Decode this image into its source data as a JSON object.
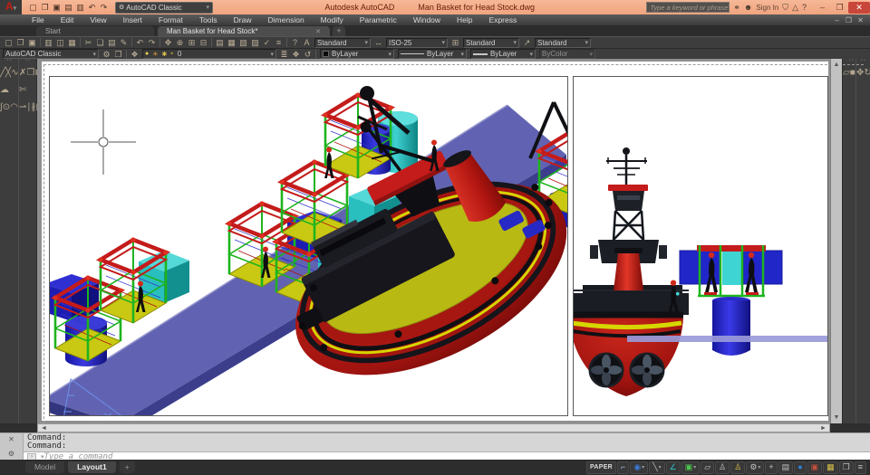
{
  "glyphs": {
    "caret": "▾",
    "close": "✕",
    "minimize": "–",
    "restore": "❐",
    "up": "▲",
    "down": "▼",
    "left": "◄",
    "right": "►",
    "grip": "• •",
    "gear": "⚙",
    "keyboard_box": "›"
  },
  "colors": {
    "titlebar_bg": "#f0a47e",
    "close_btn": "#c9473a",
    "platform_top": "#6163b2",
    "platform_side": "#3c3e8c",
    "platform_edge": "#9b9bd0",
    "cage_green": "#1eb41e",
    "cage_red": "#c41b1b",
    "base_yellow": "#c9c913",
    "teal_box": "#2abfbf",
    "teal_top": "#55d8d8",
    "navy_box": "#1d1db4",
    "navy_top": "#2f2fd2",
    "cyl_blue": "#2a2ad2",
    "hull_red": "#a81510",
    "hull_dark": "#7a0c09",
    "stripe_yellow": "#d6d600",
    "deck_yellow": "#b9b913",
    "structure_black": "#15151b",
    "lavender_bar": "#9a9ada",
    "helmet_red": "#d42a1a",
    "cyan_panel": "#3fd4d4"
  },
  "titlebar": {
    "logo_letter": "A",
    "qat_icons": [
      {
        "name": "qnew-icon",
        "glyph": "▢"
      },
      {
        "name": "open-icon",
        "glyph": "❐"
      },
      {
        "name": "save-icon",
        "glyph": "▣"
      },
      {
        "name": "save-as-icon",
        "glyph": "▤"
      },
      {
        "name": "plot-icon",
        "glyph": "▥"
      },
      {
        "name": "undo-icon",
        "glyph": "↶"
      },
      {
        "name": "redo-icon",
        "glyph": "↷"
      }
    ],
    "workspace": "AutoCAD Classic",
    "app_title": "Autodesk AutoCAD",
    "doc_title": "Man Basket for Head Stock.dwg"
  },
  "infocenter": {
    "search_placeholder": "Type a keyword or phrase",
    "icons": [
      {
        "name": "search-binoculars-icon",
        "glyph": "⚭"
      },
      {
        "name": "sign-in-user-icon",
        "glyph": "☻"
      }
    ],
    "sign_in": "Sign In",
    "right_icons": [
      {
        "name": "dropdown-icon",
        "glyph": "▾"
      },
      {
        "name": "exchange-apps-icon",
        "glyph": "⛉"
      },
      {
        "name": "autodesk360-icon",
        "glyph": "△"
      },
      {
        "name": "help-icon",
        "glyph": "?"
      }
    ]
  },
  "menus": [
    "File",
    "Edit",
    "View",
    "Insert",
    "Format",
    "Tools",
    "Draw",
    "Dimension",
    "Modify",
    "Parametric",
    "Window",
    "Help",
    "Express"
  ],
  "file_tabs": {
    "start": "Start",
    "active": "Man Basket for Head Stock*",
    "add": "+"
  },
  "toolbar_row1": {
    "icons": [
      {
        "name": "qnew-icon",
        "glyph": "▢"
      },
      {
        "name": "open-icon",
        "glyph": "❐"
      },
      {
        "name": "save-icon",
        "glyph": "▣"
      },
      {
        "name": "sep"
      },
      {
        "name": "plot-icon",
        "glyph": "▥"
      },
      {
        "name": "plot-preview-icon",
        "glyph": "◫"
      },
      {
        "name": "publish-icon",
        "glyph": "▦"
      },
      {
        "name": "sep"
      },
      {
        "name": "cut-icon",
        "glyph": "✂"
      },
      {
        "name": "copy-clip-icon",
        "glyph": "❏"
      },
      {
        "name": "paste-icon",
        "glyph": "▤"
      },
      {
        "name": "match-properties-icon",
        "glyph": "✎"
      },
      {
        "name": "sep"
      },
      {
        "name": "undo-icon",
        "glyph": "↶"
      },
      {
        "name": "redo-icon",
        "glyph": "↷"
      },
      {
        "name": "sep"
      },
      {
        "name": "pan-icon",
        "glyph": "✥"
      },
      {
        "name": "zoom-realtime-icon",
        "glyph": "⊕"
      },
      {
        "name": "zoom-window-icon",
        "glyph": "⊞"
      },
      {
        "name": "zoom-previous-icon",
        "glyph": "⊟"
      },
      {
        "name": "sep"
      },
      {
        "name": "properties-icon",
        "glyph": "▤"
      },
      {
        "name": "designcenter-icon",
        "glyph": "▦"
      },
      {
        "name": "tool-palettes-icon",
        "glyph": "▧"
      },
      {
        "name": "sheet-set-manager-icon",
        "glyph": "▨"
      },
      {
        "name": "markup-icon",
        "glyph": "✓"
      },
      {
        "name": "quickcalc-icon",
        "glyph": "≡"
      },
      {
        "name": "sep"
      },
      {
        "name": "help-icon",
        "glyph": "?"
      }
    ],
    "text_style_icon": "A",
    "text_style": "Standard",
    "dim_style_icon": "↔",
    "dim_style": "ISO-25",
    "table_style_icon": "⊞",
    "table_style": "Standard",
    "mleader_style_icon": "↗",
    "mleader_style": "Standard"
  },
  "toolbar_row2": {
    "workspace": "AutoCAD Classic",
    "gear_icon": "⚙",
    "capture_icon": "❐",
    "layer_tool_icon": "❖",
    "layer_states_icons": [
      {
        "name": "layer-on-bulb-icon",
        "glyph": "●",
        "color": "#e8d24a"
      },
      {
        "name": "layer-freeze-sun-icon",
        "glyph": "☀",
        "color": "#e8a23a"
      },
      {
        "name": "layer-plot-icon",
        "glyph": "✱",
        "color": "#d8c24a"
      },
      {
        "name": "layer-lock-icon",
        "glyph": "▪",
        "color": "#c8b030"
      }
    ],
    "layer_name": "0",
    "layer_extra_icons": [
      {
        "name": "layer-properties-icon",
        "glyph": "≣"
      },
      {
        "name": "make-layer-current-icon",
        "glyph": "❖"
      },
      {
        "name": "layer-previous-icon",
        "glyph": "↺"
      }
    ],
    "color": "ByLayer",
    "linetype": "ByLayer",
    "lineweight": "ByLayer",
    "plot_style": "ByColor"
  },
  "side_toolbars": {
    "draw": [
      {
        "name": "line-icon",
        "glyph": "╱"
      },
      {
        "name": "construction-line-icon",
        "glyph": "╳"
      },
      {
        "name": "polyline-icon",
        "glyph": "∿"
      },
      {
        "name": "polygon-icon",
        "glyph": "◇"
      },
      {
        "name": "rectangle-icon",
        "glyph": "▭"
      },
      {
        "name": "arc-icon",
        "glyph": "⌢"
      },
      {
        "name": "circle-icon",
        "glyph": "○"
      },
      {
        "name": "revision-cloud-icon",
        "glyph": "☁"
      },
      {
        "name": "spline-icon",
        "glyph": "∫"
      },
      {
        "name": "ellipse-icon",
        "glyph": "⊙"
      },
      {
        "name": "ellipse-arc-icon",
        "glyph": "◠"
      },
      {
        "name": "insert-block-icon",
        "glyph": "⊡"
      },
      {
        "name": "make-block-icon",
        "glyph": "⊞"
      },
      {
        "name": "point-icon",
        "glyph": "∙"
      },
      {
        "name": "hatch-icon",
        "glyph": "▨"
      },
      {
        "name": "gradient-icon",
        "glyph": "▓"
      },
      {
        "name": "region-icon",
        "glyph": "▣"
      },
      {
        "name": "table-icon",
        "glyph": "⊞"
      },
      {
        "name": "multiline-text-icon",
        "glyph": "A"
      },
      {
        "name": "add-selected-icon",
        "glyph": "✛"
      }
    ],
    "modify": [
      {
        "name": "erase-icon",
        "glyph": "✗"
      },
      {
        "name": "copy-icon",
        "glyph": "❐"
      },
      {
        "name": "mirror-icon",
        "glyph": "⋈"
      },
      {
        "name": "offset-icon",
        "glyph": "∥"
      },
      {
        "name": "array-icon",
        "glyph": "⣿"
      },
      {
        "name": "move-icon",
        "glyph": "✥"
      },
      {
        "name": "rotate-icon",
        "glyph": "↻"
      },
      {
        "name": "scale-icon",
        "glyph": "↗"
      },
      {
        "name": "stretch-icon",
        "glyph": "↔"
      },
      {
        "name": "trim-icon",
        "glyph": "✄"
      },
      {
        "name": "extend-icon",
        "glyph": "⇀"
      },
      {
        "name": "break-at-point-icon",
        "glyph": "∣"
      },
      {
        "name": "break-icon",
        "glyph": "∦"
      },
      {
        "name": "join-icon",
        "glyph": "∪"
      },
      {
        "name": "chamfer-icon",
        "glyph": "∠"
      },
      {
        "name": "fillet-icon",
        "glyph": "◜"
      },
      {
        "name": "blend-curves-icon",
        "glyph": "≈"
      },
      {
        "name": "explode-icon",
        "glyph": "✳"
      }
    ],
    "modeling": [
      {
        "name": "polysolid-icon",
        "glyph": "▱"
      },
      {
        "name": "box-icon",
        "glyph": "■"
      },
      {
        "name": "wedge-icon",
        "glyph": "◢"
      },
      {
        "name": "cone-icon",
        "glyph": "▲"
      },
      {
        "name": "sphere-icon",
        "glyph": "●"
      },
      {
        "name": "cylinder-icon",
        "glyph": "▮"
      },
      {
        "name": "torus-icon",
        "glyph": "◎"
      },
      {
        "name": "pyramid-icon",
        "glyph": "△"
      },
      {
        "name": "helix-icon",
        "glyph": "§"
      },
      {
        "name": "planar-surface-icon",
        "glyph": "▰"
      },
      {
        "name": "extrude-icon",
        "glyph": "⇧"
      },
      {
        "name": "presspull-icon",
        "glyph": "⇩"
      },
      {
        "name": "sweep-icon",
        "glyph": "∿"
      },
      {
        "name": "revolve-icon",
        "glyph": "↻"
      },
      {
        "name": "loft-icon",
        "glyph": "≋"
      },
      {
        "name": "union-icon",
        "glyph": "∪"
      },
      {
        "name": "subtract-icon",
        "glyph": "∖"
      },
      {
        "name": "intersect-icon",
        "glyph": "∩"
      }
    ],
    "solids": [
      {
        "name": "3d-move-icon",
        "glyph": "✥"
      },
      {
        "name": "3d-rotate-icon",
        "glyph": "↻"
      },
      {
        "name": "3d-align-icon",
        "glyph": "≡"
      },
      {
        "name": "3d-array-icon",
        "glyph": "⣿"
      },
      {
        "name": "3d-mirror-icon",
        "glyph": "⋈"
      },
      {
        "name": "fillet-edge-icon",
        "glyph": "◜"
      },
      {
        "name": "taper-faces-icon",
        "glyph": "◣"
      },
      {
        "name": "shell-icon",
        "glyph": "▢"
      },
      {
        "name": "slice-icon",
        "glyph": "◪"
      },
      {
        "name": "thicken-icon",
        "glyph": "▣"
      },
      {
        "name": "interfere-icon",
        "glyph": "◍"
      },
      {
        "name": "extract-edges-icon",
        "glyph": "◫"
      },
      {
        "name": "imprint-icon",
        "glyph": "◧"
      },
      {
        "name": "color-faces-icon",
        "glyph": "◨"
      },
      {
        "name": "copy-faces-icon",
        "glyph": "◩"
      },
      {
        "name": "check-icon",
        "glyph": "✓"
      },
      {
        "name": "sculpt-icon",
        "glyph": "◆"
      },
      {
        "name": "separate-icon",
        "glyph": "◊"
      }
    ]
  },
  "command": {
    "lines": [
      "Command:",
      "Command:"
    ],
    "placeholder": "Type a command"
  },
  "layout_tabs": {
    "model": "Model",
    "layout1": "Layout1",
    "add": "+"
  },
  "status_bar": {
    "paper": "PAPER",
    "icons": [
      {
        "name": "infer-constraints-icon",
        "glyph": "⌐",
        "color": "#9db6cf"
      },
      {
        "name": "snap-mode-icon",
        "glyph": "◉",
        "color": "#3d7bd8",
        "caret": true
      },
      {
        "name": "polar-tracking-icon",
        "glyph": "╲",
        "color": "#c2c2c2",
        "caret": true
      },
      {
        "name": "isometric-drafting-icon",
        "glyph": "∠",
        "color": "#29c5c5"
      },
      {
        "name": "object-snap-icon",
        "glyph": "▣",
        "color": "#4ec44e",
        "caret": true
      },
      {
        "name": "show-annotation-objects-icon",
        "glyph": "▱",
        "color": "#c2c2c2"
      },
      {
        "name": "annotation-autoscale-icon",
        "glyph": "♙",
        "color": "#c2c2c2"
      },
      {
        "name": "annotation-scale-icon",
        "glyph": "♙",
        "color": "#d8c24a"
      },
      {
        "name": "workspace-switching-icon",
        "glyph": "⚙",
        "color": "#c2c2c2",
        "caret": true
      },
      {
        "name": "annotation-monitor-icon",
        "glyph": "+",
        "color": "#c2c2c2"
      },
      {
        "name": "quick-properties-icon",
        "glyph": "▤",
        "color": "#c2c2c2"
      },
      {
        "name": "graphics-performance-icon",
        "glyph": "●",
        "color": "#2f80d6"
      },
      {
        "name": "isolate-objects-icon",
        "glyph": "▣",
        "color": "#c45040"
      },
      {
        "name": "hardware-acceleration-icon",
        "glyph": "▦",
        "color": "#d8c24a"
      },
      {
        "name": "clean-screen-icon",
        "glyph": "❒",
        "color": "#c2c2c2"
      },
      {
        "name": "customization-menu-icon",
        "glyph": "≡",
        "color": "#c2c2c2"
      }
    ]
  }
}
